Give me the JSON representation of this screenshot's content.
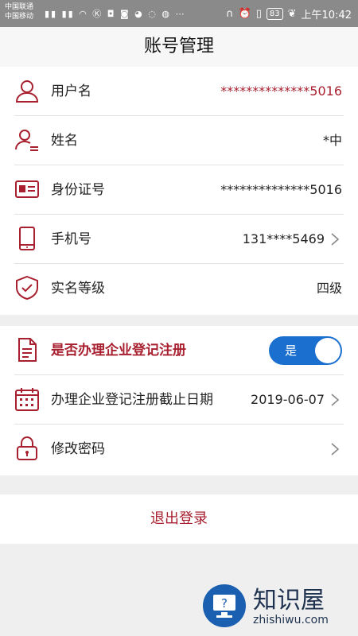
{
  "status_bar": {
    "carrier_1": "中国联通",
    "carrier_2": "中国移动",
    "battery": "83",
    "time": "上午10:42"
  },
  "header": {
    "title": "账号管理"
  },
  "account_section": [
    {
      "icon": "user-icon",
      "label": "用户名",
      "value": "**************5016",
      "value_color": "#a8202f"
    },
    {
      "icon": "person-name-icon",
      "label": "姓名",
      "value": "*中"
    },
    {
      "icon": "id-card-icon",
      "label": "身份证号",
      "value": "**************5016"
    },
    {
      "icon": "phone-icon",
      "label": "手机号",
      "value": "131****5469",
      "has_arrow": true
    },
    {
      "icon": "shield-check-icon",
      "label": "实名等级",
      "value": "四级"
    }
  ],
  "registration_section": {
    "toggle_row": {
      "icon": "document-icon",
      "label": "是否办理企业登记注册",
      "toggle_label": "是",
      "toggle_on": true
    },
    "deadline_row": {
      "icon": "calendar-icon",
      "label": "办理企业登记注册截止日期",
      "value": "2019-06-07",
      "has_arrow": true
    },
    "password_row": {
      "icon": "lock-icon",
      "label": "修改密码",
      "has_arrow": true
    }
  },
  "logout": {
    "label": "退出登录"
  },
  "watermark": {
    "brand": "知识屋",
    "url": "zhishiwu.com"
  },
  "colors": {
    "accent_red": "#a8202f",
    "toggle_blue": "#1a6fcf",
    "background": "#efefef"
  }
}
